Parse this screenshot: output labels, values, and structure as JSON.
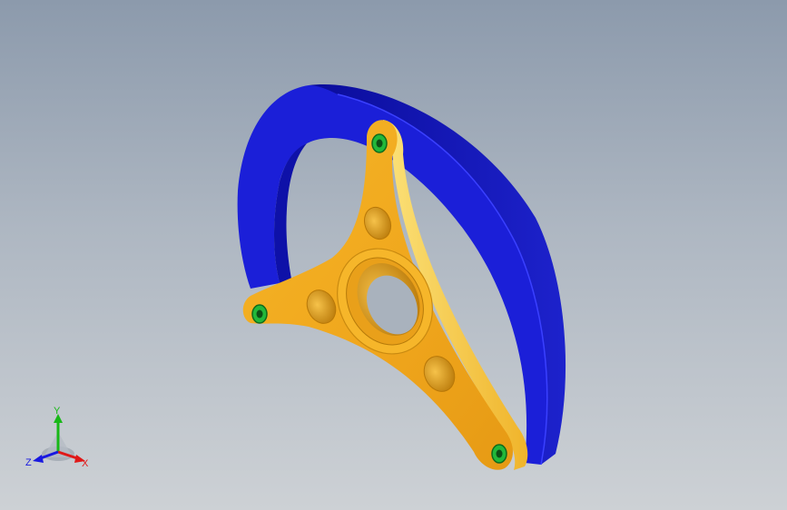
{
  "viewport": {
    "background_top": "#8c9aac",
    "background_bottom": "#cdd1d5"
  },
  "model": {
    "rim_color": "#1b1fd8",
    "hub_color": "#f2a91e",
    "fastener_color": "#22b83a"
  },
  "triad": {
    "x_label": "X",
    "y_label": "Y",
    "z_label": "Z",
    "x_color": "#e01818",
    "y_color": "#18b818",
    "z_color": "#1818e0"
  }
}
